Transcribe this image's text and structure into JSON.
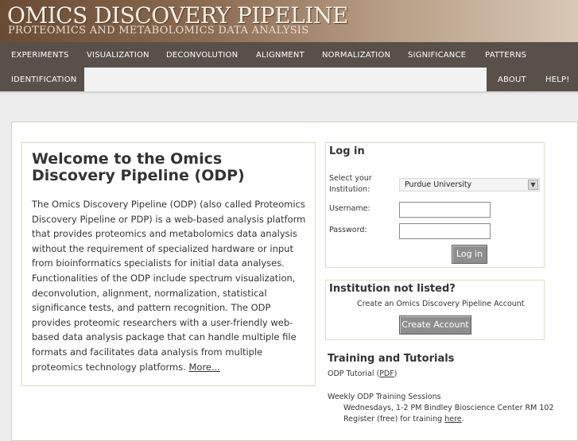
{
  "banner": {
    "title": "OMICS DISCOVERY PIPELINE",
    "subtitle": "PROTEOMICS AND METABOLOMICS DATA ANALYSIS"
  },
  "nav": {
    "row1": [
      "EXPERIMENTS",
      "VISUALIZATION",
      "DECONVOLUTION",
      "ALIGNMENT",
      "NORMALIZATION",
      "SIGNIFICANCE",
      "PATTERNS"
    ],
    "identification": "IDENTIFICATION",
    "about": "ABOUT",
    "help": "HELP!"
  },
  "welcome": {
    "heading": "Welcome to the Omics Discovery Pipeline (ODP)",
    "body": "The Omics Discovery Pipeline (ODP) (also called Proteomics Discovery Pipeline or PDP) is a web-based analysis platform that provides proteomics and metabolomics data analysis without the requirement of specialized hardware or input from bioinformatics specialists for initial data analyses. Functionalities of the ODP include spectrum visualization, deconvolution, alignment, normalization, statistical significance tests, and pattern recognition. The ODP provides proteomic researchers with a user-friendly web-based data analysis package that can handle multiple file formats and facilitates data analysis from multiple proteomics technology platforms.",
    "more_link": "More..."
  },
  "login": {
    "title": "Log in",
    "institution_label": "Select your Institution:",
    "institution_value": "Purdue University",
    "username_label": "Username:",
    "password_label": "Password:",
    "button": "Log in"
  },
  "institution": {
    "title": "Institution not listed?",
    "create_text": "Create an Omics Discovery Pipeline Account",
    "button": "Create Account"
  },
  "training": {
    "title": "Training and Tutorials",
    "tutorial_prefix": "ODP Tutorial (",
    "tutorial_link": "PDF",
    "tutorial_suffix": ")",
    "sessions_title": "Weekly ODP Training Sessions",
    "sessions_time": "Wednesdays, 1-2 PM Bindley Bioscience Center RM 102",
    "register_prefix": "Register (free) for training ",
    "register_link": "here",
    "register_suffix": "."
  }
}
